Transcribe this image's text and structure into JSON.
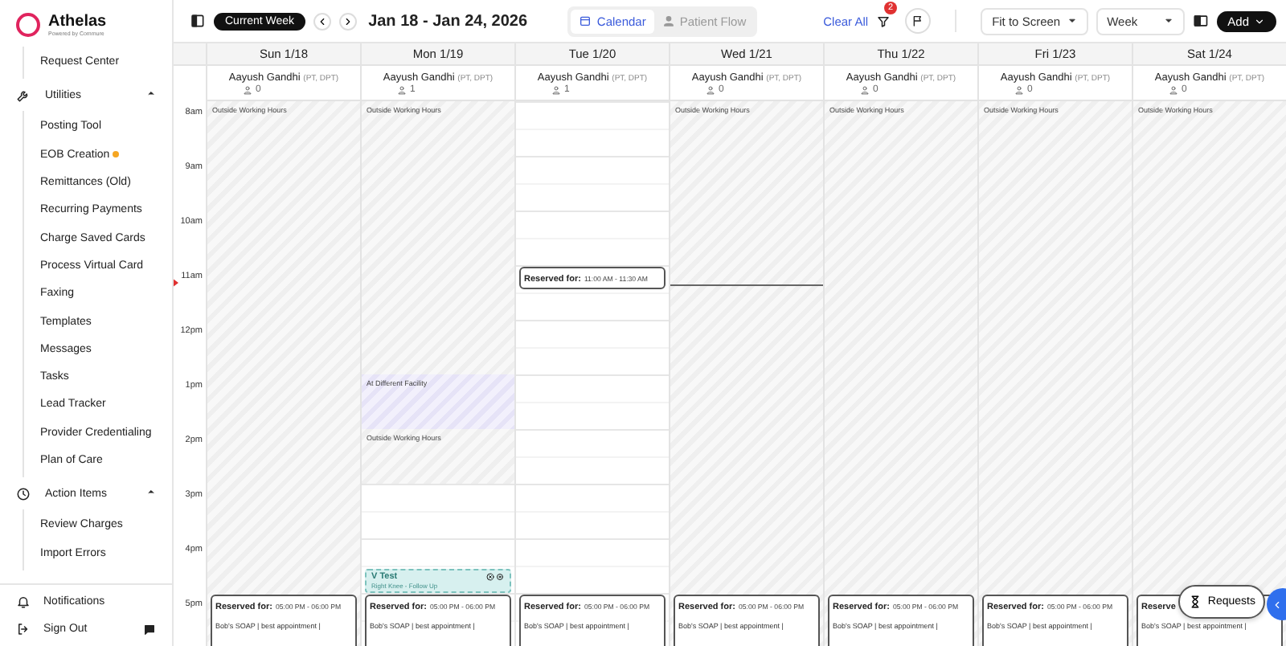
{
  "sidebar": {
    "logo": {
      "name": "Athelas",
      "tagline": "Powered by Commure"
    },
    "groups": [
      {
        "children": [
          {
            "label": "Request Center",
            "alert": false
          }
        ]
      },
      {
        "label": "Utilities",
        "expanded": true,
        "children": [
          {
            "label": "Posting Tool",
            "alert": false
          },
          {
            "label": "EOB Creation",
            "alert": true
          },
          {
            "label": "Remittances (Old)",
            "alert": false
          },
          {
            "label": "Recurring Payments",
            "alert": false
          },
          {
            "label": "Charge Saved Cards",
            "alert": false
          },
          {
            "label": "Process Virtual Card",
            "alert": false
          },
          {
            "label": "Faxing",
            "alert": false
          },
          {
            "label": "Templates",
            "alert": false
          },
          {
            "label": "Messages",
            "alert": false
          },
          {
            "label": "Tasks",
            "alert": false
          },
          {
            "label": "Lead Tracker",
            "alert": false
          },
          {
            "label": "Provider Credentialing",
            "alert": false
          },
          {
            "label": "Plan of Care",
            "alert": false
          }
        ]
      },
      {
        "label": "Action Items",
        "expanded": true,
        "children": [
          {
            "label": "Review Charges",
            "alert": false
          },
          {
            "label": "Import Errors",
            "alert": false
          }
        ]
      }
    ],
    "footer": [
      {
        "label": "Notifications"
      },
      {
        "label": "Sign Out"
      }
    ]
  },
  "toolbar": {
    "current_week": "Current Week",
    "range": "Jan 18 - Jan 24, 2026",
    "views": [
      {
        "label": "Calendar",
        "selected": true
      },
      {
        "label": "Patient Flow",
        "selected": false
      }
    ],
    "clear_all": "Clear All",
    "filter_count": "2",
    "zoom": "Fit to Screen",
    "period": "Week",
    "add": "Add"
  },
  "hours": [
    "8am",
    "9am",
    "10am",
    "11am",
    "12pm",
    "1pm",
    "2pm",
    "3pm",
    "4pm",
    "5pm"
  ],
  "days": [
    {
      "label": "Sun 1/18",
      "provider": "Aayush Gandhi",
      "credentials": "(PT, DPT)",
      "count": "0",
      "slots": [
        {
          "kind": "outside",
          "label": "Outside Working Hours"
        },
        {
          "kind": "outside"
        },
        {
          "kind": "outside"
        },
        {
          "kind": "outside"
        },
        {
          "kind": "outside"
        },
        {
          "kind": "outside"
        },
        {
          "kind": "outside"
        },
        {
          "kind": "outside"
        },
        {
          "kind": "outside"
        },
        {
          "kind": "outside"
        },
        {
          "kind": "outside"
        },
        {
          "kind": "outside"
        },
        {
          "kind": "outside"
        },
        {
          "kind": "outside"
        },
        {
          "kind": "outside"
        },
        {
          "kind": "outside"
        },
        {
          "kind": "outside"
        },
        {
          "kind": "outside"
        },
        {
          "kind": "outside",
          "events": [
            {
              "kind": "reserved",
              "title": "Reserved for:",
              "time": "05:00 PM - 06:00 PM",
              "detail": "Bob's SOAP | best appointment |"
            }
          ]
        },
        {
          "kind": "outside"
        }
      ]
    },
    {
      "label": "Mon 1/19",
      "provider": "Aayush Gandhi",
      "credentials": "(PT, DPT)",
      "count": "1",
      "slots": [
        {
          "kind": "outside",
          "label": "Outside Working Hours"
        },
        {
          "kind": "outside"
        },
        {
          "kind": "outside"
        },
        {
          "kind": "outside"
        },
        {
          "kind": "outside"
        },
        {
          "kind": "outside"
        },
        {
          "kind": "outside"
        },
        {
          "kind": "outside"
        },
        {
          "kind": "outside"
        },
        {
          "kind": "outside"
        },
        {
          "kind": "facility",
          "label": "At Different Facility"
        },
        {
          "kind": "facility"
        },
        {
          "kind": "outside",
          "label": "Outside Working Hours"
        },
        {
          "kind": "outside"
        },
        {
          "kind": "open"
        },
        {
          "kind": "open"
        },
        {
          "kind": "open"
        },
        {
          "kind": "open",
          "events": [
            {
              "kind": "appointment",
              "title": "V Test",
              "detail": "Right Knee - Follow Up"
            }
          ]
        },
        {
          "kind": "open",
          "events": [
            {
              "kind": "reserved",
              "title": "Reserved for:",
              "time": "05:00 PM - 06:00 PM",
              "detail": "Bob's SOAP | best appointment |"
            }
          ]
        },
        {
          "kind": "open"
        }
      ]
    },
    {
      "label": "Tue 1/20",
      "provider": "Aayush Gandhi",
      "credentials": "(PT, DPT)",
      "count": "1",
      "slots": [
        {
          "kind": "open"
        },
        {
          "kind": "open"
        },
        {
          "kind": "open"
        },
        {
          "kind": "open"
        },
        {
          "kind": "open"
        },
        {
          "kind": "open"
        },
        {
          "kind": "open",
          "events": [
            {
              "kind": "reserved",
              "title": "Reserved for:",
              "time": "11:00 AM - 11:30 AM"
            }
          ]
        },
        {
          "kind": "open"
        },
        {
          "kind": "open"
        },
        {
          "kind": "open"
        },
        {
          "kind": "open"
        },
        {
          "kind": "open"
        },
        {
          "kind": "open"
        },
        {
          "kind": "open"
        },
        {
          "kind": "open"
        },
        {
          "kind": "open"
        },
        {
          "kind": "open"
        },
        {
          "kind": "open"
        },
        {
          "kind": "open",
          "events": [
            {
              "kind": "reserved",
              "title": "Reserved for:",
              "time": "05:00 PM - 06:00 PM",
              "detail": "Bob's SOAP | best appointment |"
            }
          ]
        },
        {
          "kind": "open"
        }
      ]
    },
    {
      "label": "Wed 1/21",
      "provider": "Aayush Gandhi",
      "credentials": "(PT, DPT)",
      "count": "0",
      "slots": [
        {
          "kind": "outside",
          "label": "Outside Working Hours"
        },
        {
          "kind": "outside"
        },
        {
          "kind": "outside"
        },
        {
          "kind": "outside"
        },
        {
          "kind": "outside"
        },
        {
          "kind": "outside"
        },
        {
          "kind": "outside",
          "now": true
        },
        {
          "kind": "outside"
        },
        {
          "kind": "outside"
        },
        {
          "kind": "outside"
        },
        {
          "kind": "outside"
        },
        {
          "kind": "outside"
        },
        {
          "kind": "outside"
        },
        {
          "kind": "outside"
        },
        {
          "kind": "outside"
        },
        {
          "kind": "outside"
        },
        {
          "kind": "outside"
        },
        {
          "kind": "outside"
        },
        {
          "kind": "outside",
          "events": [
            {
              "kind": "reserved",
              "title": "Reserved for:",
              "time": "05:00 PM - 06:00 PM",
              "detail": "Bob's SOAP | best appointment |"
            }
          ]
        },
        {
          "kind": "outside"
        }
      ]
    },
    {
      "label": "Thu 1/22",
      "provider": "Aayush Gandhi",
      "credentials": "(PT, DPT)",
      "count": "0",
      "slots": [
        {
          "kind": "outside",
          "label": "Outside Working Hours"
        },
        {
          "kind": "outside"
        },
        {
          "kind": "outside"
        },
        {
          "kind": "outside"
        },
        {
          "kind": "outside"
        },
        {
          "kind": "outside"
        },
        {
          "kind": "outside"
        },
        {
          "kind": "outside"
        },
        {
          "kind": "outside"
        },
        {
          "kind": "outside"
        },
        {
          "kind": "outside"
        },
        {
          "kind": "outside"
        },
        {
          "kind": "outside"
        },
        {
          "kind": "outside"
        },
        {
          "kind": "outside"
        },
        {
          "kind": "outside"
        },
        {
          "kind": "outside"
        },
        {
          "kind": "outside"
        },
        {
          "kind": "outside",
          "events": [
            {
              "kind": "reserved",
              "title": "Reserved for:",
              "time": "05:00 PM - 06:00 PM",
              "detail": "Bob's SOAP | best appointment |"
            }
          ]
        },
        {
          "kind": "outside"
        }
      ]
    },
    {
      "label": "Fri 1/23",
      "provider": "Aayush Gandhi",
      "credentials": "(PT, DPT)",
      "count": "0",
      "slots": [
        {
          "kind": "outside",
          "label": "Outside Working Hours"
        },
        {
          "kind": "outside"
        },
        {
          "kind": "outside"
        },
        {
          "kind": "outside"
        },
        {
          "kind": "outside"
        },
        {
          "kind": "outside"
        },
        {
          "kind": "outside"
        },
        {
          "kind": "outside"
        },
        {
          "kind": "outside"
        },
        {
          "kind": "outside"
        },
        {
          "kind": "outside"
        },
        {
          "kind": "outside"
        },
        {
          "kind": "outside"
        },
        {
          "kind": "outside"
        },
        {
          "kind": "outside"
        },
        {
          "kind": "outside"
        },
        {
          "kind": "outside"
        },
        {
          "kind": "outside"
        },
        {
          "kind": "outside",
          "events": [
            {
              "kind": "reserved",
              "title": "Reserved for:",
              "time": "05:00 PM - 06:00 PM",
              "detail": "Bob's SOAP | best appointment |"
            }
          ]
        },
        {
          "kind": "outside"
        }
      ]
    },
    {
      "label": "Sat 1/24",
      "provider": "Aayush Gandhi",
      "credentials": "(PT, DPT)",
      "count": "0",
      "slots": [
        {
          "kind": "outside",
          "label": "Outside Working Hours"
        },
        {
          "kind": "outside"
        },
        {
          "kind": "outside"
        },
        {
          "kind": "outside"
        },
        {
          "kind": "outside"
        },
        {
          "kind": "outside"
        },
        {
          "kind": "outside"
        },
        {
          "kind": "outside"
        },
        {
          "kind": "outside"
        },
        {
          "kind": "outside"
        },
        {
          "kind": "outside"
        },
        {
          "kind": "outside"
        },
        {
          "kind": "outside"
        },
        {
          "kind": "outside"
        },
        {
          "kind": "outside"
        },
        {
          "kind": "outside"
        },
        {
          "kind": "outside"
        },
        {
          "kind": "outside"
        },
        {
          "kind": "outside",
          "events": [
            {
              "kind": "reserved",
              "title": "Reserve",
              "detail": "Bob's SOAP | best appointment |"
            }
          ]
        },
        {
          "kind": "outside"
        }
      ]
    }
  ],
  "requests_button": "Requests"
}
